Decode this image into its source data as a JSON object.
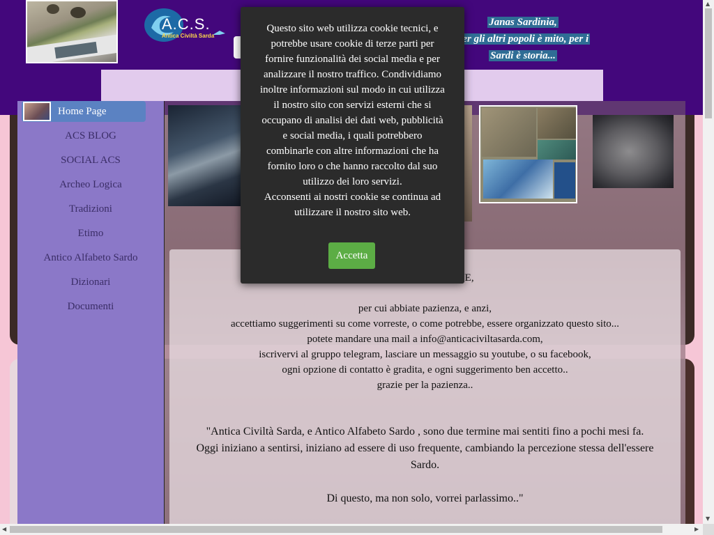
{
  "header": {
    "logo_text": "A.C.S.",
    "logo_subtitle": "Antica Civiltà Sarda",
    "tagline_lines": [
      "Janas Sardinia,",
      "per gli altri popoli è mito, per i",
      "Sardi è storia..."
    ]
  },
  "sidebar": {
    "items": [
      {
        "label": "Home Page",
        "active": true
      },
      {
        "label": "ACS BLOG"
      },
      {
        "label": "SOCIAL ACS"
      },
      {
        "label": "Archeo Logica"
      },
      {
        "label": "Tradizioni"
      },
      {
        "label": "Etimo"
      },
      {
        "label": "Antico Alfabeto Sardo"
      },
      {
        "label": "Dizionari"
      },
      {
        "label": "Documenti"
      }
    ]
  },
  "content": {
    "line_partial": "RUZIONE,",
    "lines": [
      "per cui abbiate pazienza, e anzi,",
      "accettiamo suggerimenti su come vorreste, o come potrebbe, essere organizzato questo sito...",
      "potete mandare una mail a info@anticaciviltasarda.com,",
      "iscrivervi al gruppo telegram, lasciare un messaggio su youtube, o su facebook,",
      "ogni opzione di contatto è gradita,  e ogni suggerimento ben accetto..",
      "grazie per la pazienza.."
    ],
    "quote_lines": [
      "\"Antica Civiltà Sarda, e Antico Alfabeto Sardo , sono due termine mai sentiti fino a pochi mesi fa.",
      "Oggi iniziano a sentirsi, iniziano ad essere di uso frequente, cambiando la percezione stessa dell'essere",
      "Sardo."
    ],
    "closing": "Di questo, ma non solo, vorrei parlassimo..\""
  },
  "cookie": {
    "text_lines": [
      "Questo sito web utilizza cookie tecnici, e",
      "potrebbe usare cookie di terze parti per",
      "fornire funzionalità dei social media e per",
      "analizzare il nostro traffico. Condividiamo",
      "inoltre informazioni sul modo in cui utilizza",
      "il nostro sito con servizi esterni che si",
      "occupano di analisi dei dati web, pubblicità",
      "e social media, i quali potrebbero",
      "combinarle con altre informazioni che ha",
      "fornito loro o che hanno raccolto dal suo",
      "utilizzo dei loro servizi.",
      "Acconsenti ai nostri cookie se continua ad",
      "utilizzare il nostro sito web."
    ],
    "accept_label": "Accetta"
  },
  "colors": {
    "header_bg": "#43077c",
    "sidebar_bg": "#8b78c8",
    "active_nav": "#5b82c2",
    "accept_button": "#5cad45",
    "dialog_bg": "#2b2b2b"
  },
  "icons": [
    "scroll-up-arrow-icon",
    "scroll-down-arrow-icon",
    "scroll-left-arrow-icon",
    "scroll-right-arrow-icon"
  ]
}
